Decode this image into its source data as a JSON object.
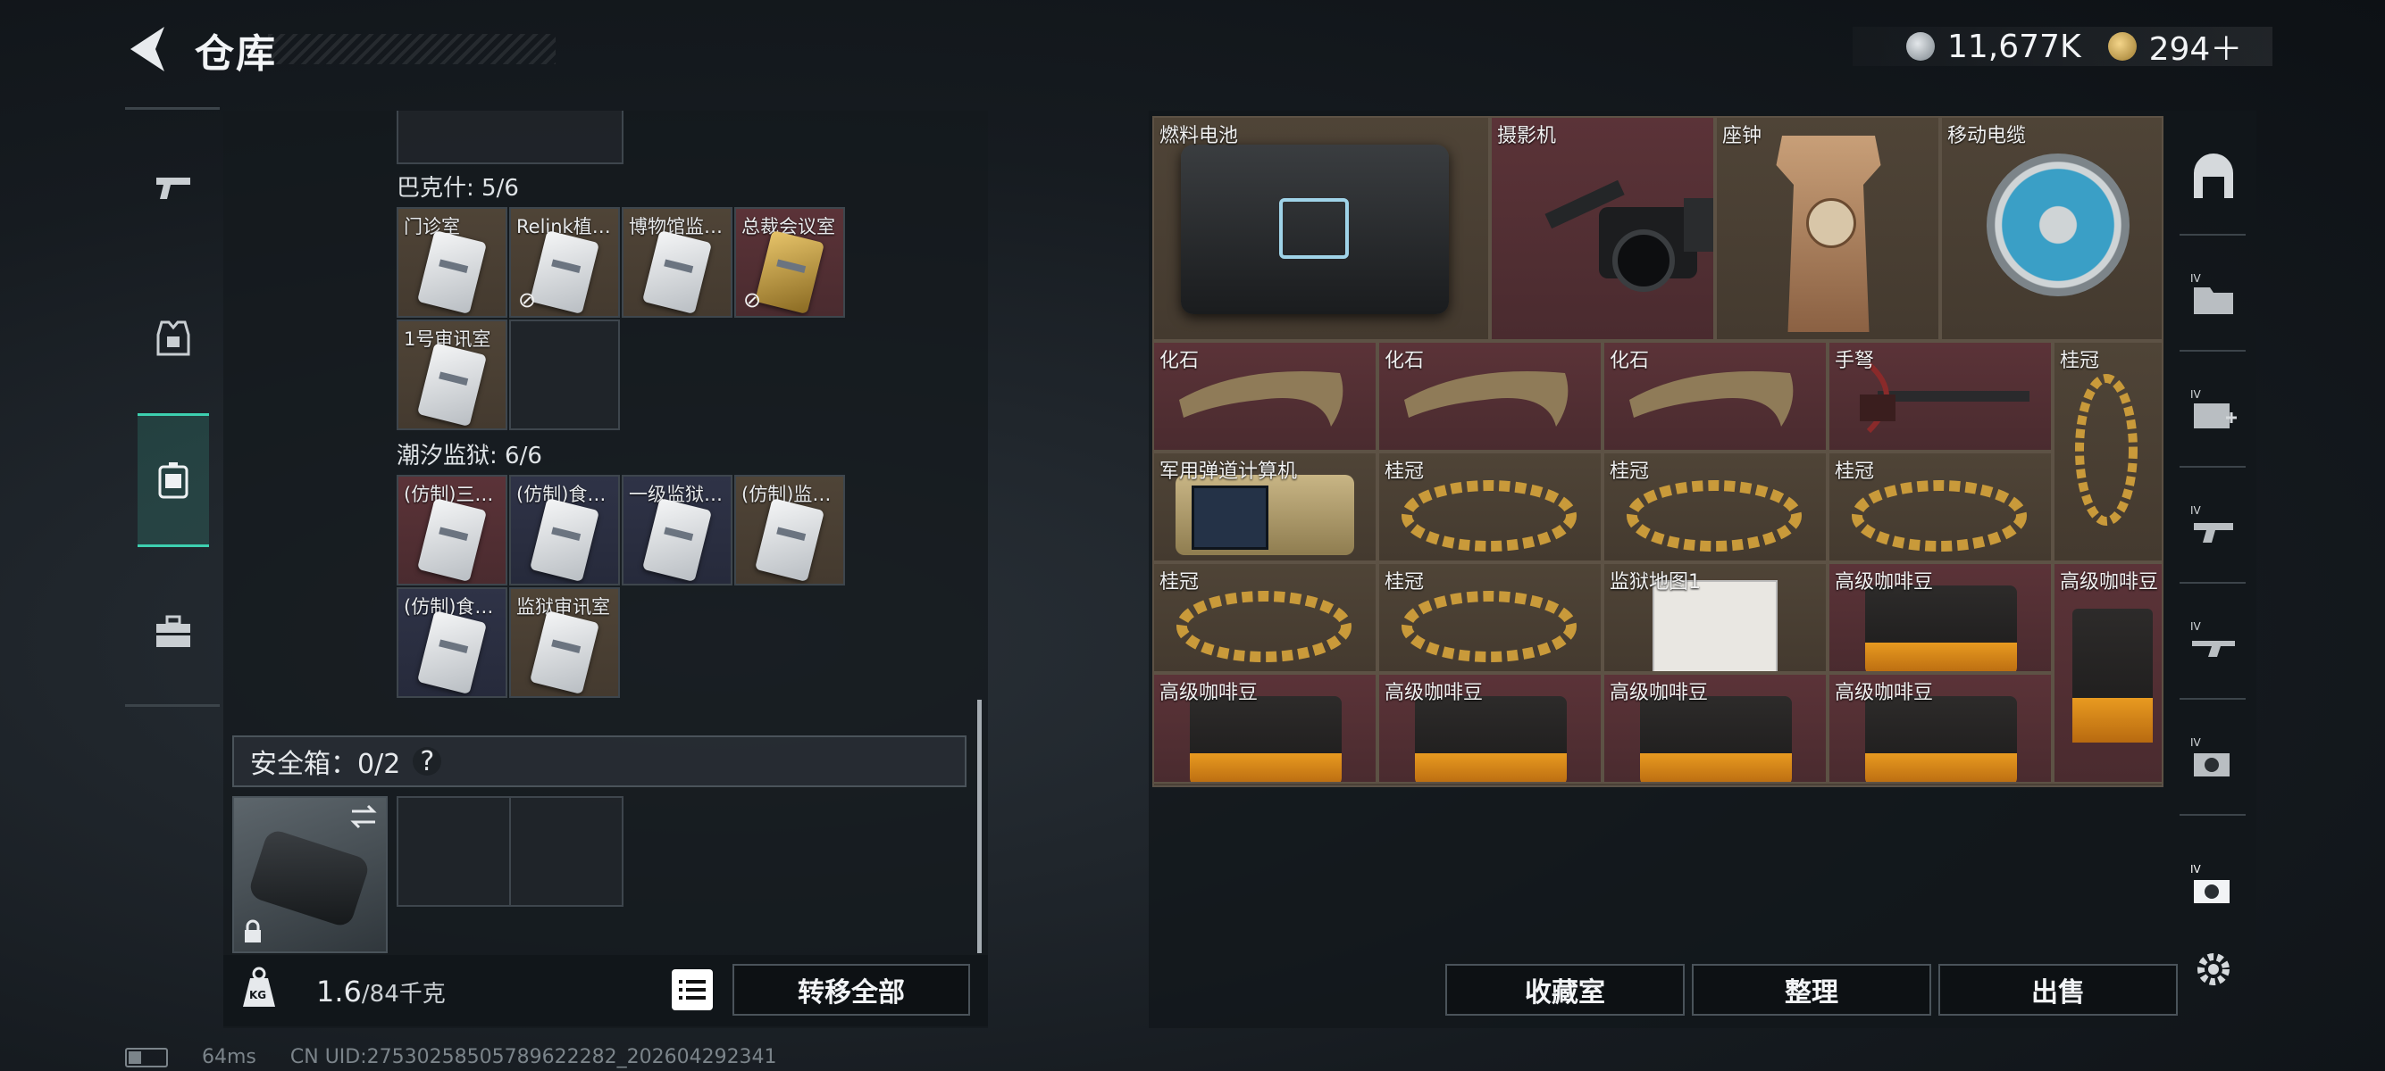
{
  "header": {
    "title": "仓库",
    "currency": [
      {
        "icon": "silver-coin-icon",
        "value": "11,677K"
      },
      {
        "icon": "gold-coin-icon",
        "value": "294＋"
      }
    ]
  },
  "left_tabs": [
    {
      "icon": "pistol-icon",
      "active": false
    },
    {
      "icon": "armor-vest-icon",
      "active": false
    },
    {
      "icon": "backpack-icon",
      "active": true
    },
    {
      "icon": "toolbox-icon",
      "active": false
    }
  ],
  "keycards": {
    "groups": [
      {
        "title": "巴克什: 5/6",
        "items": [
          {
            "label": "门诊室",
            "color": "brown"
          },
          {
            "label": "Relink植…",
            "color": "brown",
            "no_card": true
          },
          {
            "label": "博物馆监…",
            "color": "brown"
          },
          {
            "label": "总裁会议室",
            "color": "red",
            "no_card": true
          },
          {
            "label": "1号审讯室",
            "color": "brown"
          }
        ]
      },
      {
        "title": "潮汐监狱: 6/6",
        "items": [
          {
            "label": "(仿制)三…",
            "color": "red"
          },
          {
            "label": "(仿制)食…",
            "color": "navy"
          },
          {
            "label": "一级监狱…",
            "color": "navy"
          },
          {
            "label": "(仿制)监…",
            "color": "brown"
          },
          {
            "label": "(仿制)食…",
            "color": "navy"
          },
          {
            "label": "监狱审讯室",
            "color": "brown"
          }
        ]
      }
    ]
  },
  "safe_box": {
    "label": "安全箱：0/2",
    "help": "?"
  },
  "left_footer": {
    "weight_current": "1.6",
    "weight_max": "/84千克",
    "weight_icon_text": "KG",
    "transfer_all": "转移全部"
  },
  "stash_items": [
    {
      "label": "燃料电池",
      "bg": "brown",
      "art": "battery"
    },
    {
      "label": "摄影机",
      "bg": "red",
      "art": "camera"
    },
    {
      "label": "座钟",
      "bg": "brown",
      "art": "clock"
    },
    {
      "label": "移动电缆",
      "bg": "brown",
      "art": "reel"
    },
    {
      "label": "化石",
      "bg": "red",
      "art": "fossil"
    },
    {
      "label": "化石",
      "bg": "red",
      "art": "fossil"
    },
    {
      "label": "化石",
      "bg": "red",
      "art": "fossil"
    },
    {
      "label": "手弩",
      "bg": "red",
      "art": "crossbow"
    },
    {
      "label": "桂冠",
      "bg": "brown",
      "art": "laurel-v"
    },
    {
      "label": "军用弹道计算机",
      "bg": "brown",
      "art": "calc"
    },
    {
      "label": "桂冠",
      "bg": "brown",
      "art": "laurel"
    },
    {
      "label": "桂冠",
      "bg": "brown",
      "art": "laurel"
    },
    {
      "label": "桂冠",
      "bg": "brown",
      "art": "laurel"
    },
    {
      "label": "桂冠",
      "bg": "brown",
      "art": "laurel"
    },
    {
      "label": "桂冠",
      "bg": "brown",
      "art": "laurel"
    },
    {
      "label": "监狱地图1",
      "bg": "brown",
      "art": "map"
    },
    {
      "label": "高级咖啡豆",
      "bg": "red",
      "art": "coffee"
    },
    {
      "label": "高级咖啡豆",
      "bg": "red",
      "art": "coffee-v"
    },
    {
      "label": "高级咖啡豆",
      "bg": "red",
      "art": "coffee"
    },
    {
      "label": "高级咖啡豆",
      "bg": "red",
      "art": "coffee"
    },
    {
      "label": "高级咖啡豆",
      "bg": "red",
      "art": "coffee"
    },
    {
      "label": "高级咖啡豆",
      "bg": "red",
      "art": "coffee"
    }
  ],
  "right_footer": {
    "collection": "收藏室",
    "sort": "整理",
    "sell": "出售"
  },
  "right_rail": [
    {
      "icon": "stash-home-icon"
    },
    {
      "icon": "iv-folder-icon"
    },
    {
      "icon": "iv-medkit-icon"
    },
    {
      "icon": "iv-gun-icon"
    },
    {
      "icon": "iv-rifle-icon"
    },
    {
      "icon": "iv-camera-icon"
    },
    {
      "icon": "iv-camera-selected-icon"
    }
  ],
  "status": {
    "ping": "64ms",
    "uid": "CN UID:27530258505789622282_202604292341"
  }
}
